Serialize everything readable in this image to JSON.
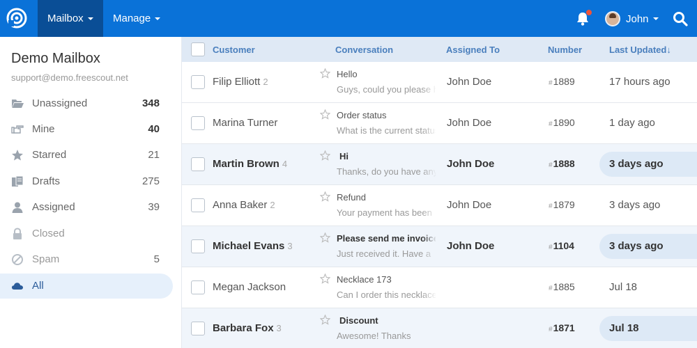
{
  "nav": {
    "items": [
      {
        "label": "Mailbox"
      },
      {
        "label": "Manage"
      }
    ],
    "user_name": "John"
  },
  "sidebar": {
    "mailbox_name": "Demo Mailbox",
    "mailbox_email": "support@demo.freescout.net",
    "folders": [
      {
        "label": "Unassigned",
        "count": "348",
        "icon": "folder-open-icon"
      },
      {
        "label": "Mine",
        "count": "40",
        "icon": "hand-pointing-icon"
      },
      {
        "label": "Starred",
        "count": "21",
        "icon": "star-icon"
      },
      {
        "label": "Drafts",
        "count": "275",
        "icon": "drafts-icon"
      },
      {
        "label": "Assigned",
        "count": "39",
        "icon": "user-icon"
      },
      {
        "label": "Closed",
        "count": "",
        "icon": "lock-icon"
      },
      {
        "label": "Spam",
        "count": "5",
        "icon": "ban-icon"
      },
      {
        "label": "All",
        "count": "",
        "icon": "cloud-icon"
      }
    ]
  },
  "table": {
    "headers": {
      "customer": "Customer",
      "conversation": "Conversation",
      "assigned": "Assigned To",
      "number": "Number",
      "updated": "Last Updated",
      "sort_arrow": "↓"
    },
    "hash": "#",
    "rows": [
      {
        "customer": "Filip Elliott",
        "threads": "2",
        "subject": "Hello",
        "preview": "Guys, could you please help",
        "assignee": "John Doe",
        "number": "1889",
        "updated": "17 hours ago"
      },
      {
        "customer": "Marina Turner",
        "threads": "",
        "subject": "Order status",
        "preview": "What is the current status",
        "assignee": "John Doe",
        "number": "1890",
        "updated": "1 day ago"
      },
      {
        "customer": "Martin Brown",
        "threads": "4",
        "subject": "Hi",
        "preview": "Thanks, do you have any",
        "assignee": "John Doe",
        "number": "1888",
        "updated": "3 days ago"
      },
      {
        "customer": "Anna Baker",
        "threads": "2",
        "subject": "Refund",
        "preview": "Your payment has been",
        "assignee": "John Doe",
        "number": "1879",
        "updated": "3 days ago"
      },
      {
        "customer": "Michael Evans",
        "threads": "3",
        "subject": "Please send me invoice",
        "preview": "Just received it. Have a",
        "assignee": "John Doe",
        "number": "1104",
        "updated": "3 days ago"
      },
      {
        "customer": "Megan Jackson",
        "threads": "",
        "subject": "Necklace 173",
        "preview": "Can I order this necklace",
        "assignee": "",
        "number": "1885",
        "updated": "Jul 18"
      },
      {
        "customer": "Barbara Fox",
        "threads": "3",
        "subject": "Discount",
        "preview": "Awesome! Thanks",
        "assignee": "",
        "number": "1871",
        "updated": "Jul 18"
      }
    ]
  },
  "colors": {
    "topbar": "#0a72d8",
    "nav_active": "#0a4e96",
    "header_row": "#dfe9f5",
    "unread_row": "#f0f5fb",
    "notification_dot": "#f0533a"
  }
}
